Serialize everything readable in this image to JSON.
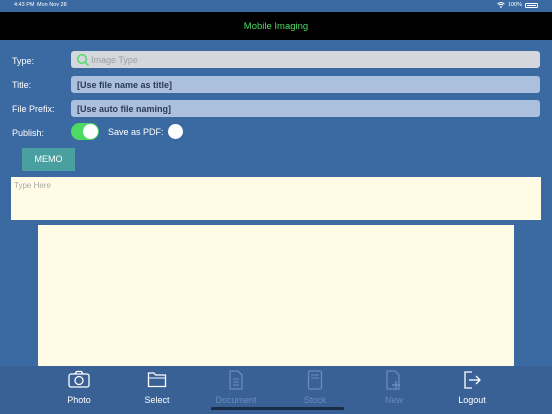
{
  "status_bar": {
    "time": "4:43 PM",
    "date": "Mon Nov 28",
    "battery": "100%"
  },
  "nav": {
    "title": "Mobile Imaging"
  },
  "form": {
    "type_label": "Type:",
    "type_placeholder": "Image Type",
    "title_label": "Title:",
    "title_value": "[Use file name as title]",
    "prefix_label": "File Prefix:",
    "prefix_value": "[Use auto file naming]",
    "publish_label": "Publish:",
    "publish_on": true,
    "save_pdf_label": "Save as PDF:",
    "save_pdf_on": false
  },
  "memo": {
    "button_label": "MEMO",
    "placeholder": "Type Here"
  },
  "tabs": [
    {
      "label": "Photo",
      "icon": "camera-icon",
      "enabled": true
    },
    {
      "label": "Select",
      "icon": "folder-icon",
      "enabled": true
    },
    {
      "label": "Document",
      "icon": "document-icon",
      "enabled": false
    },
    {
      "label": "Stock",
      "icon": "stock-icon",
      "enabled": false
    },
    {
      "label": "New",
      "icon": "new-document-icon",
      "enabled": false
    },
    {
      "label": "Logout",
      "icon": "logout-icon",
      "enabled": true
    }
  ],
  "colors": {
    "background": "#3b6aa3",
    "accent_green": "#4cd964",
    "memo_teal": "#4a9fa0",
    "paper": "#fffbe5"
  }
}
